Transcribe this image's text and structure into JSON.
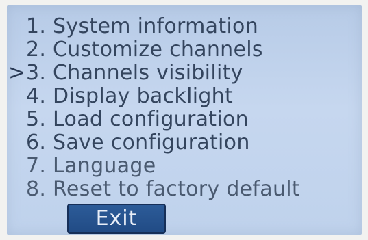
{
  "menu": {
    "cursor": ">",
    "selected_index": 2,
    "items": [
      {
        "label": "1. System information"
      },
      {
        "label": "2. Customize channels"
      },
      {
        "label": "3. Channels visibility"
      },
      {
        "label": "4. Display backlight"
      },
      {
        "label": "5. Load configuration"
      },
      {
        "label": "6. Save configuration"
      },
      {
        "label": "7. Language"
      },
      {
        "label": "8. Reset to factory default"
      }
    ]
  },
  "exit_button": {
    "label": "Exit"
  },
  "colors": {
    "screen_background": "#c0d3ec",
    "text": "#34455e",
    "button_background": "#2c5b98",
    "button_text": "#e8eef8"
  }
}
